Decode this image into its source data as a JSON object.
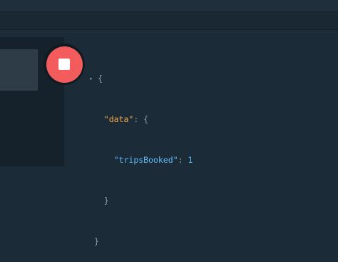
{
  "stop_button": {
    "icon": "stop-icon",
    "color": "#f25c5c"
  },
  "response": {
    "collapse_arrow": "▾",
    "open_brace": "{",
    "data_key": "\"data\"",
    "data_colon": ":",
    "data_open": "{",
    "trips_key": "\"tripsBooked\"",
    "trips_colon": ":",
    "trips_value": "1",
    "inner_close": "}",
    "outer_close": "}"
  },
  "colors": {
    "background": "#1c2b38",
    "key_data": "#f3a64a",
    "key_trips": "#5fb9f2",
    "number": "#5fb9f2"
  }
}
